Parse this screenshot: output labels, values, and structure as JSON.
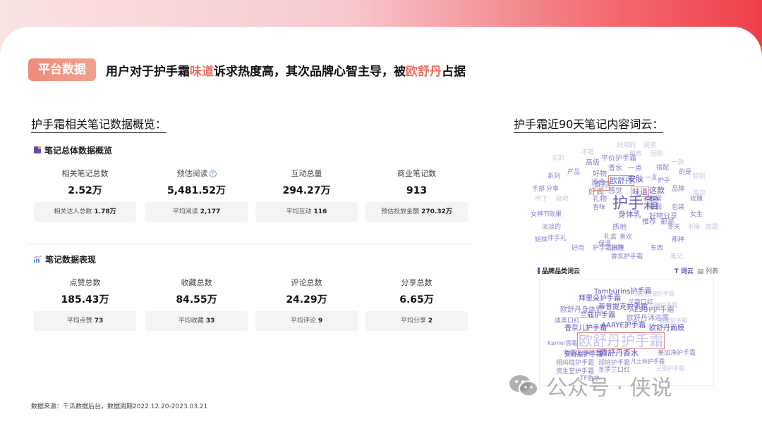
{
  "header": {
    "tag": "平台数据",
    "headline_parts": [
      "用户对于护手霜",
      "味道",
      "诉求热度高，其次品牌心智主导，被",
      "欧舒丹",
      "占据"
    ]
  },
  "left_section": {
    "title": "护手霜相关笔记数据概览：",
    "overview": {
      "title": "笔记总体数据概览",
      "metrics": [
        {
          "label": "相关笔记总数",
          "value": "2.52万",
          "sub_label": "相关达人总数",
          "sub_value": "1.78万"
        },
        {
          "label": "预估阅读",
          "value": "5,481.52万",
          "sub_label": "平均阅读",
          "sub_value": "2,177"
        },
        {
          "label": "互动总量",
          "value": "294.27万",
          "sub_label": "平均互动",
          "sub_value": "116"
        },
        {
          "label": "商业笔记数",
          "value": "913",
          "sub_label": "预估投放金额",
          "sub_value": "270.32万"
        }
      ]
    },
    "performance": {
      "title": "笔记数据表现",
      "metrics": [
        {
          "label": "点赞总数",
          "value": "185.43万",
          "sub_label": "平均点赞",
          "sub_value": "73"
        },
        {
          "label": "收藏总数",
          "value": "84.55万",
          "sub_label": "平均收藏",
          "sub_value": "33"
        },
        {
          "label": "评论总数",
          "value": "24.29万",
          "sub_label": "平均评论",
          "sub_value": "9"
        },
        {
          "label": "分享总数",
          "value": "6.65万",
          "sub_label": "平均分享",
          "sub_value": "2"
        }
      ]
    },
    "footnote": "数据来源：千瓜数据后台，数据周期2022.12.20-2023.03.21"
  },
  "right_section": {
    "title": "护手霜近90天笔记内容词云：",
    "word_cloud": [
      "好用的",
      "闺蜜",
      "不错",
      "买的",
      "精致",
      "回购",
      "高级",
      "平价护手霜",
      "一款",
      "香水",
      "一点",
      "搭配",
      "系列",
      "好物",
      "产品",
      "的是",
      "特别",
      "适合",
      "欧舒丹",
      "安肤",
      "一支",
      "护手",
      "手部",
      "分享",
      "好闻",
      "真的",
      "味道",
      "这款",
      "品牌",
      "每次",
      "用了",
      "吸收",
      "感觉",
      "礼物",
      "日常",
      "玫瑰",
      "香味",
      "护手霜",
      "滋润",
      "包装",
      "女神节",
      "效果",
      "身体乳",
      "好物分享",
      "女生",
      "淡淡的",
      "质地",
      "推荐",
      "都是",
      "冬天",
      "干燥",
      "面霜",
      "礼盒",
      "喜欢",
      "护肤",
      "伴手礼",
      "护手霜推荐",
      "姐妹",
      "保湿",
      "好用",
      "香氛护手霜",
      "东西",
      "笔记",
      "那种"
    ],
    "brand_cloud": {
      "title": "品牌品类词云",
      "tab_cloud": "词云",
      "tab_list": "列表",
      "words": [
        "Tamburins护手霜",
        "雅诗兰黛护手霜",
        "拜里朵护手霜",
        "兰蔻口红",
        "艾琳护手霜",
        "欧舒丹身体乳",
        "蒂普提克护手霜",
        "AESOP护手霜",
        "兰蔻护手霜",
        "欧舒丹沐浴露",
        "迪奥口红",
        "迪奥护手霜",
        "香奈儿护手霜",
        "AARYE护手霜",
        "欧舒丹面膜",
        "Kamer面霜",
        "欧舒丹护手霜",
        "安野屋护手霜",
        "海蓝之谜护手霜",
        "欧舒丹香水",
        "美加净护手霜",
        "祖玛珑护手霜",
        "润培护手霜",
        "凡士林护手霜",
        "资生堂护手霜",
        "圣罗兰口红",
        "TF香水",
        "兰蔻护手霜"
      ]
    }
  },
  "watermark": {
    "text": "公众号 · 侠说"
  },
  "colors": {
    "accent": "#ef6f5f",
    "cloud_purple": "#5b4fb5",
    "cloud_light": "#b4aee0"
  }
}
